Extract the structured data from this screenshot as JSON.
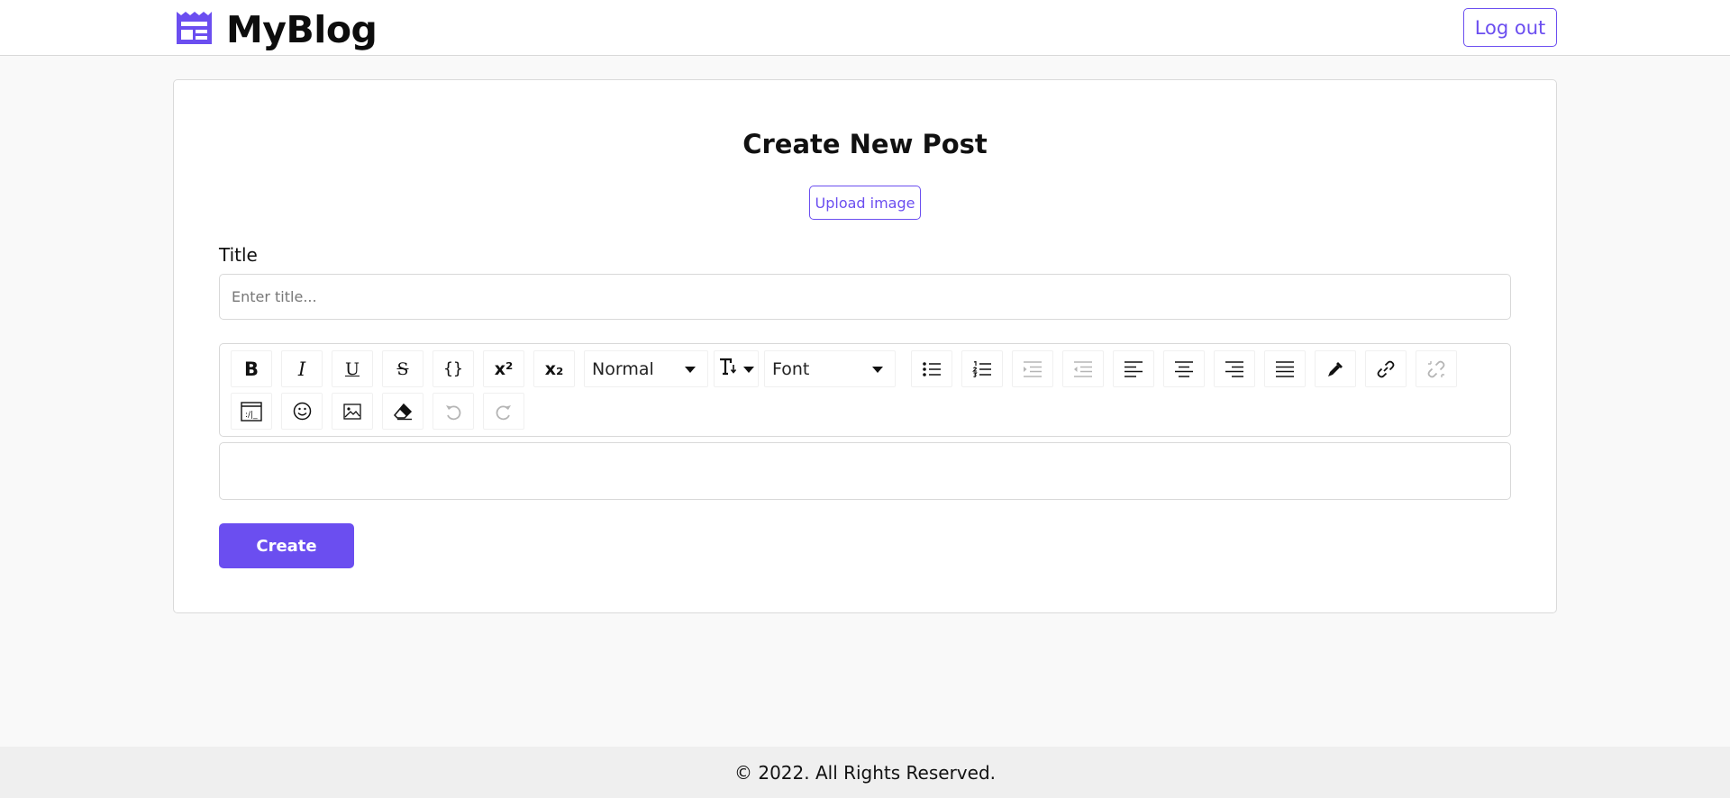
{
  "header": {
    "brand": "MyBlog",
    "logout_label": "Log out",
    "accent_color": "#6b4ef0"
  },
  "form": {
    "page_title": "Create New Post",
    "upload_label": "Upload image",
    "title_label": "Title",
    "title_placeholder": "Enter title...",
    "title_value": "",
    "create_label": "Create"
  },
  "toolbar": {
    "row1": [
      {
        "name": "bold-button",
        "icon": "bold-icon",
        "glyph": "B",
        "enabled": true
      },
      {
        "name": "italic-button",
        "icon": "italic-icon",
        "glyph": "I",
        "enabled": true
      },
      {
        "name": "underline-button",
        "icon": "underline-icon",
        "glyph": "U",
        "enabled": true
      },
      {
        "name": "strikethrough-button",
        "icon": "strikethrough-icon",
        "glyph": "S",
        "enabled": true
      },
      {
        "name": "code-button",
        "icon": "code-braces-icon",
        "glyph": "{}",
        "enabled": true
      },
      {
        "name": "superscript-button",
        "icon": "superscript-icon",
        "glyph": "x²",
        "enabled": true
      },
      {
        "name": "subscript-button",
        "icon": "subscript-icon",
        "glyph": "x₂",
        "enabled": true
      },
      {
        "name": "block-type-select",
        "value": "Normal"
      },
      {
        "name": "font-size-select",
        "icon": "font-size-icon"
      },
      {
        "name": "font-family-select",
        "value": "Font"
      },
      {
        "name": "unordered-list-button",
        "icon": "bullet-list-icon",
        "enabled": true
      },
      {
        "name": "ordered-list-button",
        "icon": "numbered-list-icon",
        "enabled": true
      },
      {
        "name": "indent-button",
        "icon": "indent-icon",
        "enabled": false
      },
      {
        "name": "outdent-button",
        "icon": "outdent-icon",
        "enabled": false
      },
      {
        "name": "align-left-button",
        "icon": "align-left-icon",
        "enabled": true
      },
      {
        "name": "align-center-button",
        "icon": "align-center-icon",
        "enabled": true
      },
      {
        "name": "align-right-button",
        "icon": "align-right-icon",
        "enabled": true
      },
      {
        "name": "align-justify-button",
        "icon": "align-justify-icon",
        "enabled": true
      },
      {
        "name": "color-picker-button",
        "icon": "eyedropper-icon",
        "enabled": true
      },
      {
        "name": "link-button",
        "icon": "link-icon",
        "enabled": true
      },
      {
        "name": "unlink-button",
        "icon": "unlink-icon",
        "enabled": false
      }
    ],
    "row2": [
      {
        "name": "embedded-button",
        "icon": "embed-icon",
        "enabled": true
      },
      {
        "name": "emoji-button",
        "icon": "emoji-icon",
        "enabled": true
      },
      {
        "name": "image-button",
        "icon": "image-icon",
        "enabled": true
      },
      {
        "name": "remove-format-button",
        "icon": "eraser-icon",
        "enabled": true
      },
      {
        "name": "undo-button",
        "icon": "undo-icon",
        "enabled": false
      },
      {
        "name": "redo-button",
        "icon": "redo-icon",
        "enabled": false
      }
    ]
  },
  "footer": {
    "text": "© 2022. All Rights Reserved."
  }
}
